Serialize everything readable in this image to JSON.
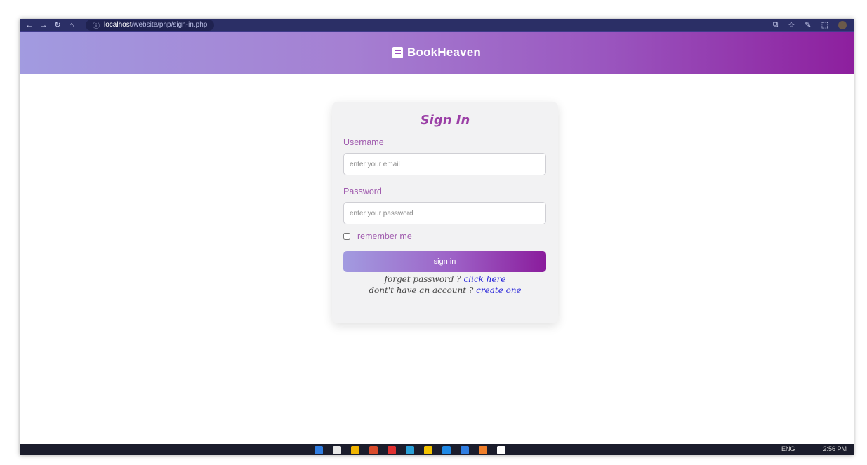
{
  "browser": {
    "url_prefix": "localhost",
    "url_path": "/website/php/sign-in.php",
    "nav_icons": [
      "←",
      "→",
      "↻",
      "⌂"
    ],
    "right_icons": [
      "⧉",
      "☆",
      "✎",
      "⬚",
      "⋮"
    ]
  },
  "header": {
    "brand_icon": "book-icon",
    "brand_name": "BookHeaven"
  },
  "form": {
    "title": "Sign In",
    "username_label": "Username",
    "username_placeholder": "enter your email",
    "password_label": "Password",
    "password_placeholder": "enter your password",
    "remember_label": "remember me",
    "remember_checked": false,
    "submit_label": "sign in",
    "forget_text": "forget password ?",
    "forget_link": "click here",
    "account_text": "dont't have an account ?",
    "account_link": "create one"
  },
  "taskbar": {
    "lang": "ENG",
    "time": "2:56 PM",
    "app_colors": [
      "#2f7de1",
      "#e8e8e8",
      "#f0b400",
      "#d94b2b",
      "#e03030",
      "#29a0d8",
      "#f2c200",
      "#1e88e5",
      "#2f7de1",
      "#f07f2a",
      "#ffffff"
    ]
  },
  "colors": {
    "accent": "#9b3fa6",
    "gradient_start": "#a29be0",
    "gradient_end": "#8d1f9e",
    "link": "#2b27d9"
  }
}
